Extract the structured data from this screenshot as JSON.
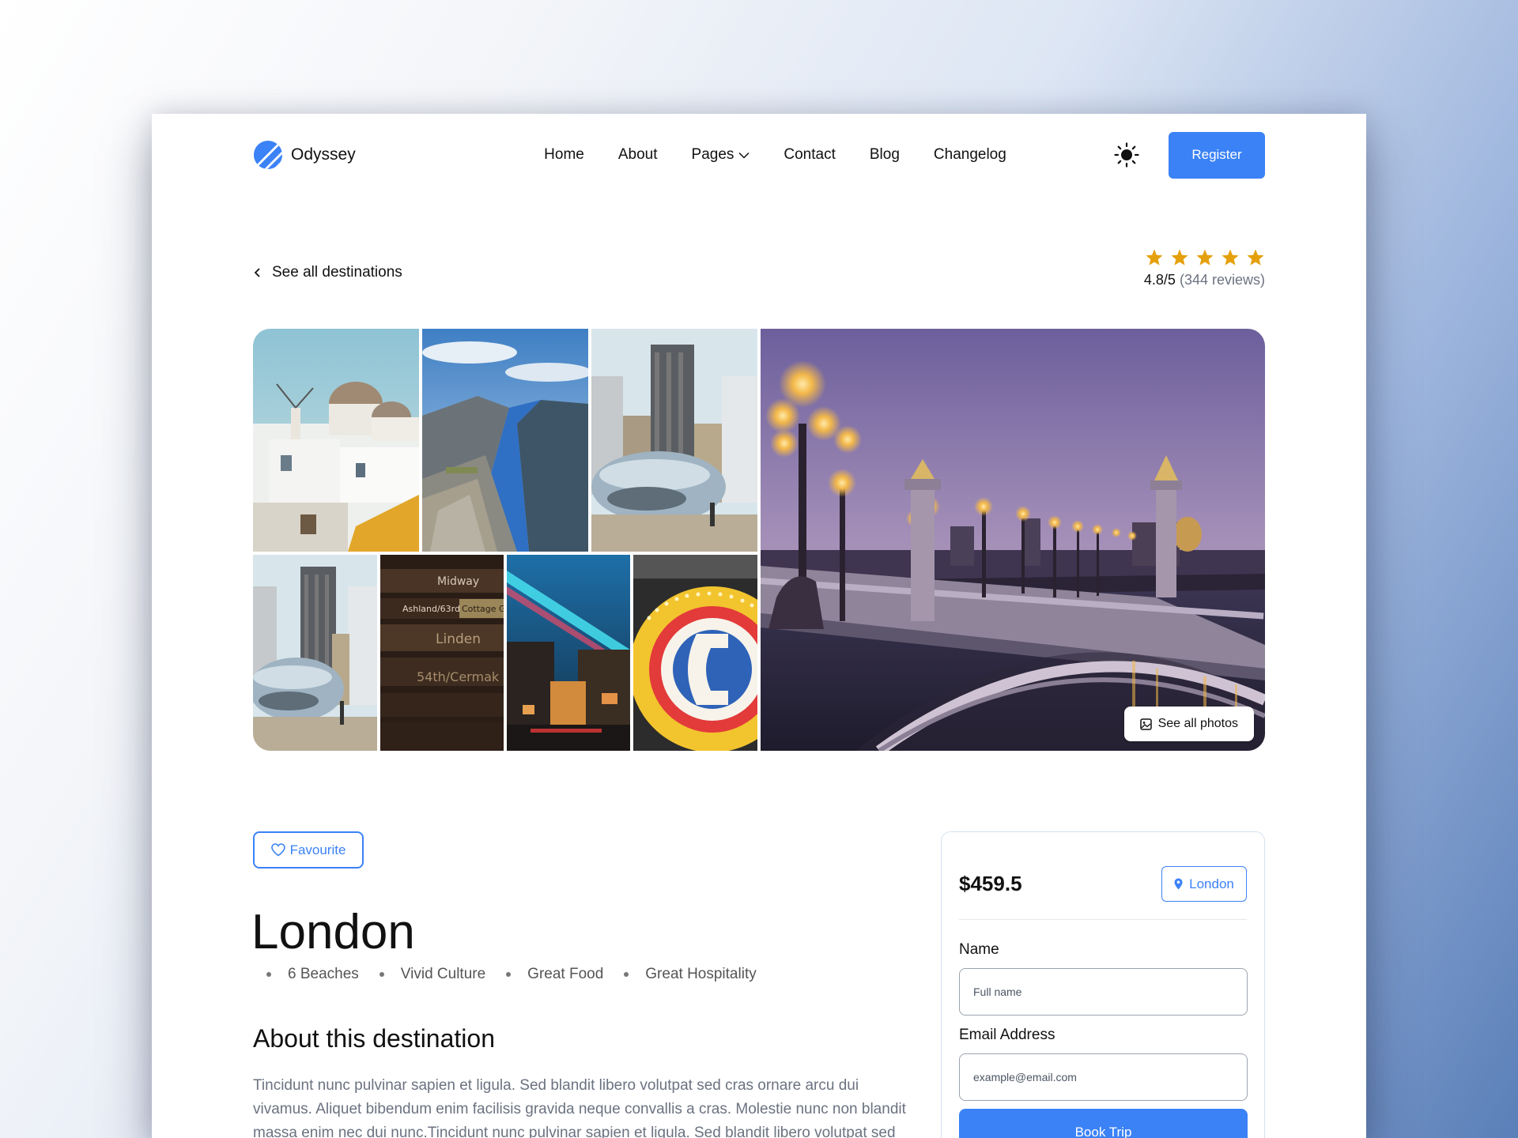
{
  "nav": {
    "brand": "Odyssey",
    "items": [
      {
        "label": "Home"
      },
      {
        "label": "About"
      },
      {
        "label": "Pages"
      },
      {
        "label": "Contact"
      },
      {
        "label": "Blog"
      },
      {
        "label": "Changelog"
      }
    ],
    "register_label": "Register"
  },
  "back_link": "See all destinations",
  "rating": {
    "stars": 5,
    "score": "4.8/5",
    "reviews": "(344 reviews)",
    "star_color": "#e5a00d"
  },
  "gallery": {
    "see_all_label": "See all photos",
    "sign_texts": [
      "Midway",
      "Ashland/63rd",
      "Cottage G",
      "Linden",
      "54th/Cermak"
    ]
  },
  "destination": {
    "favourite_label": "Favourite",
    "title": "London",
    "features": [
      "6 Beaches",
      "Vivid Culture",
      "Great Food",
      "Great Hospitality"
    ],
    "about_heading": "About this destination",
    "about_text": "Tincidunt nunc pulvinar sapien et ligula. Sed blandit libero volutpat sed cras ornare arcu dui vivamus. Aliquet bibendum enim facilisis gravida neque convallis a cras. Molestie nunc non blandit massa enim nec dui nunc.Tincidunt nunc pulvinar sapien et ligula. Sed blandit libero volutpat sed cras"
  },
  "booking": {
    "price": "$459.5",
    "location": "London",
    "name_label": "Name",
    "name_placeholder": "Full name",
    "email_label": "Email Address",
    "email_placeholder": "example@email.com",
    "book_label": "Book Trip"
  },
  "colors": {
    "accent": "#3b82f6",
    "star": "#e5a00d"
  }
}
